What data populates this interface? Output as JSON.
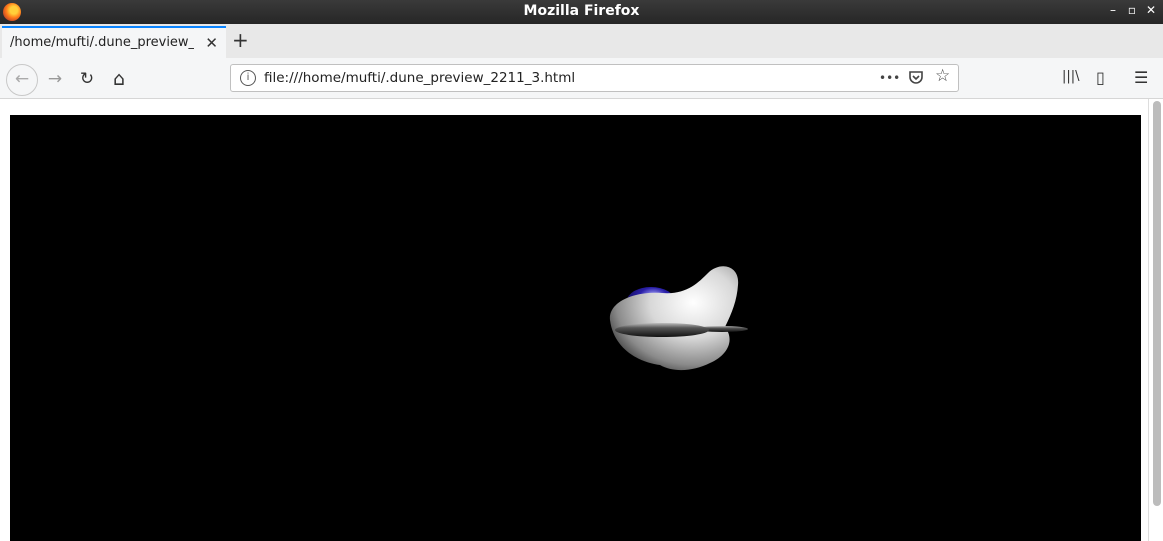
{
  "window": {
    "title": "Mozilla Firefox"
  },
  "tab": {
    "label": "/home/mufti/.dune_preview_",
    "close_glyph": "✕"
  },
  "newtab": {
    "glyph": "+"
  },
  "nav": {
    "back": "←",
    "forward": "→",
    "reload": "↻",
    "home": "⌂"
  },
  "urlbar": {
    "value": "file:///home/mufti/.dune_preview_2211_3.html",
    "info_glyph": "i",
    "more_glyph": "•••",
    "star_glyph": "☆"
  },
  "toolbar": {
    "library_glyph": "|||\\",
    "sidebar_glyph": "▯",
    "menu_glyph": "☰"
  },
  "winctl": {
    "minimize": "–",
    "maximize": "▫",
    "close": "✕"
  },
  "scene": {
    "background": "#000000",
    "hull_color": "#dcdcdc",
    "canopy_color": "#2a1fa8"
  }
}
